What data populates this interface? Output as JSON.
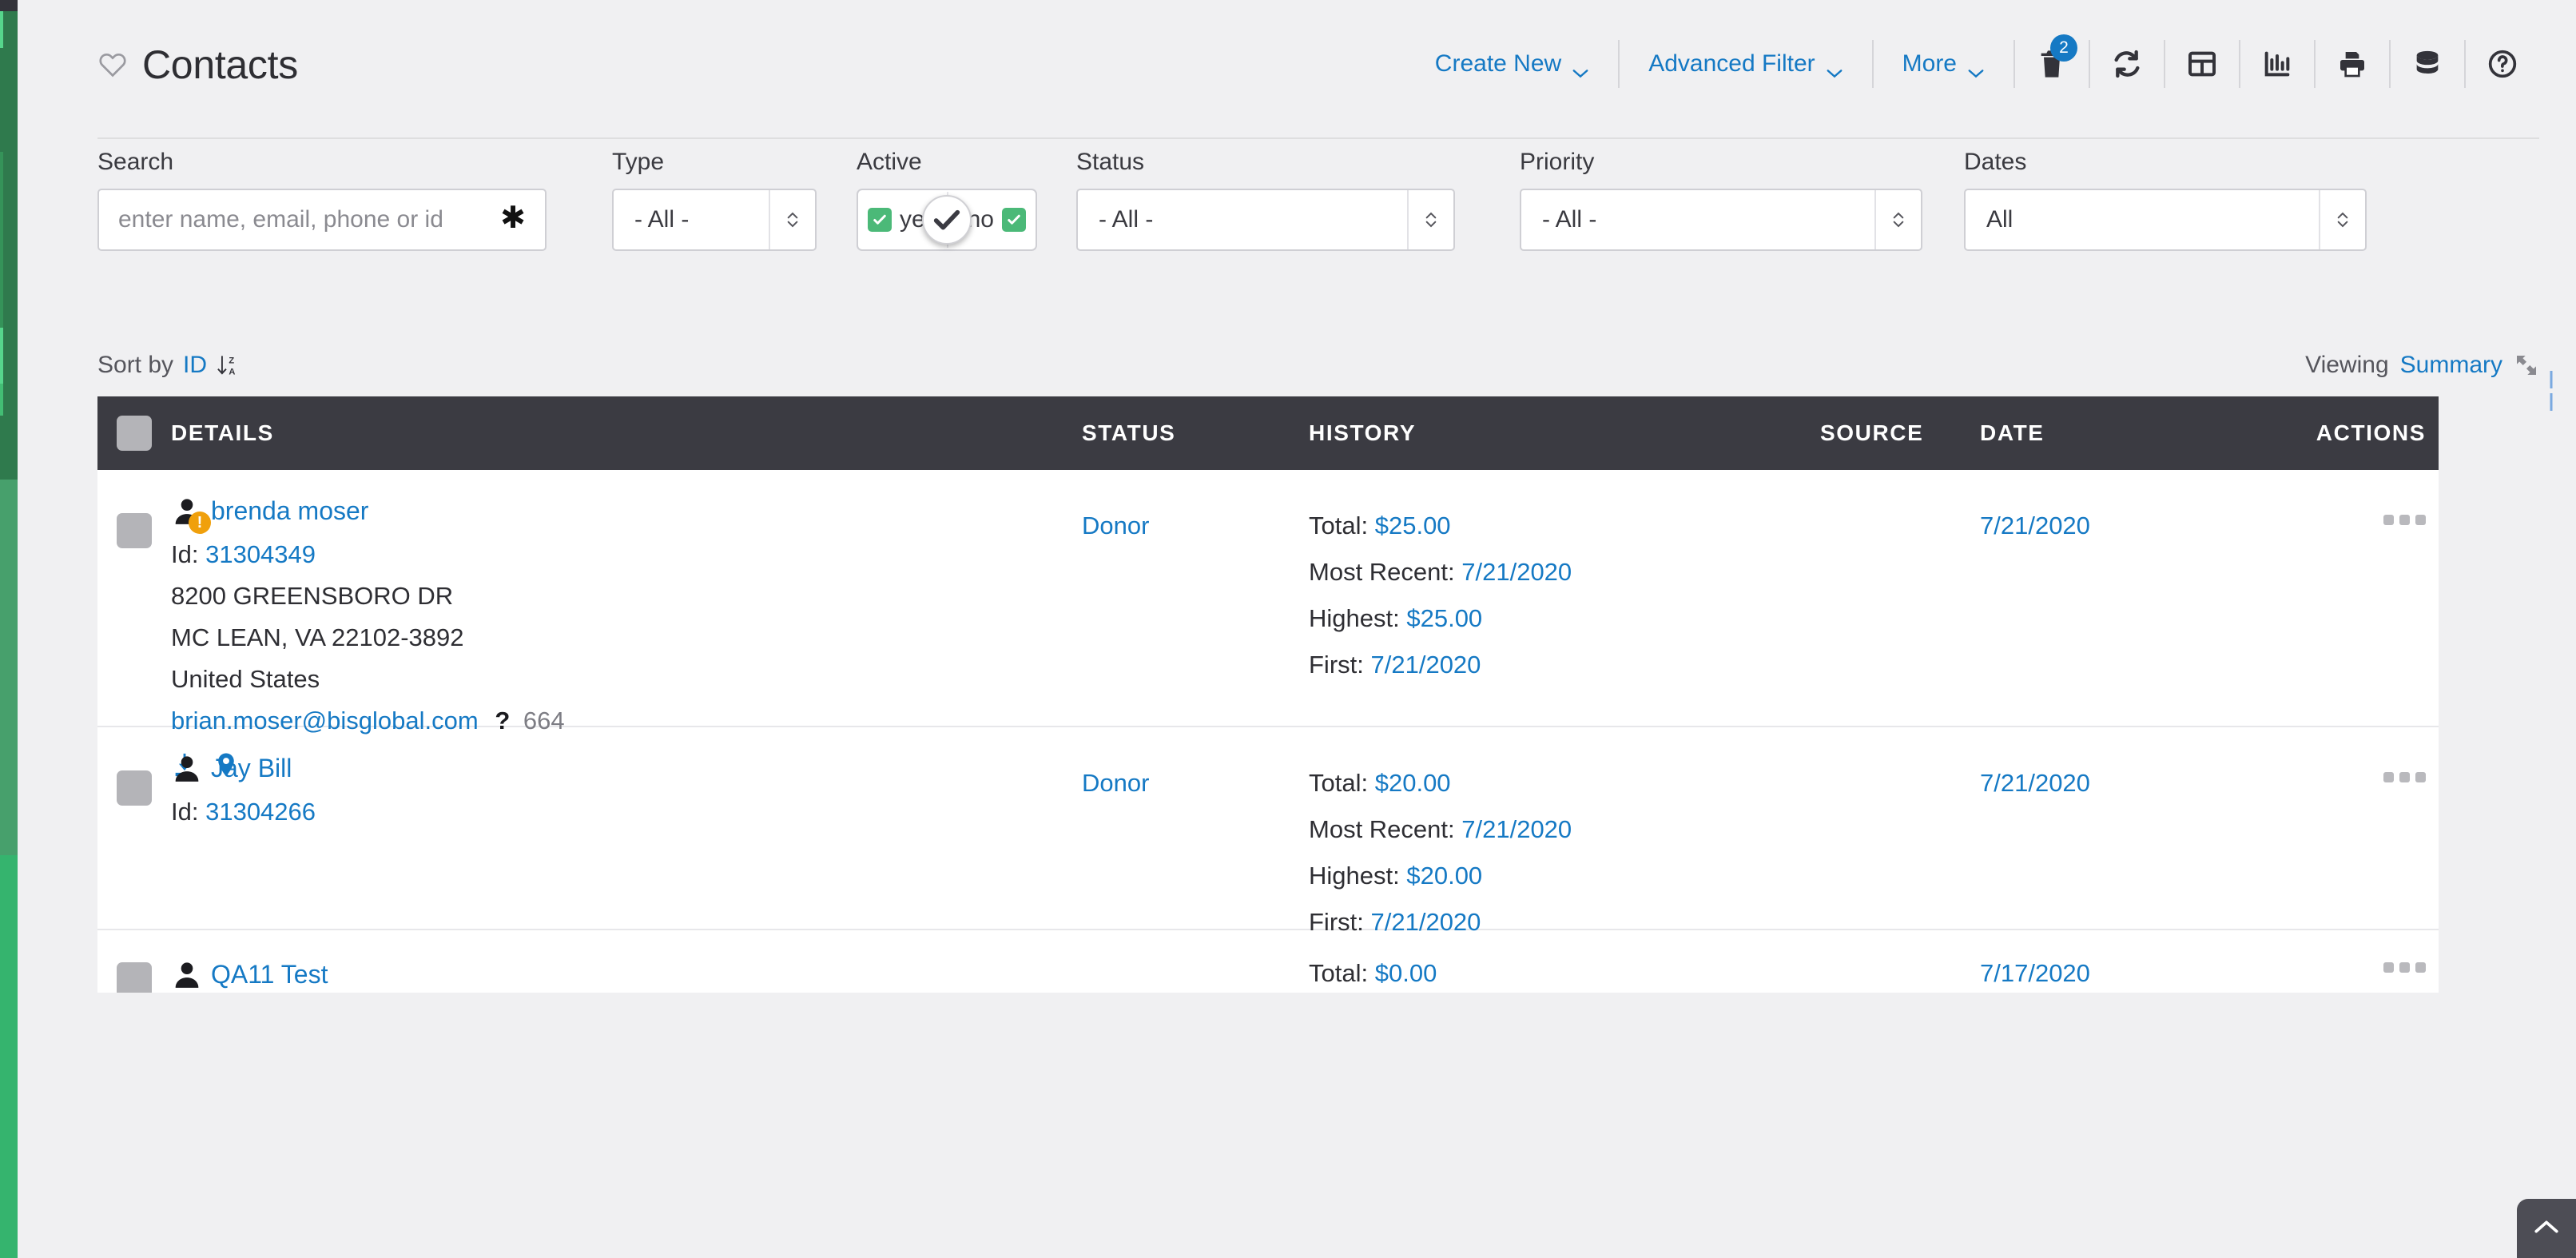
{
  "header": {
    "title": "Contacts",
    "heart_icon": "heart-outline-icon",
    "actions": [
      {
        "label": "Create New",
        "icon": "chevron-down-icon"
      },
      {
        "label": "Advanced Filter",
        "icon": "chevron-down-icon"
      },
      {
        "label": "More",
        "icon": "chevron-down-icon"
      }
    ],
    "icon_buttons": [
      {
        "name": "trash-icon",
        "badge": "2"
      },
      {
        "name": "refresh-icon",
        "badge": ""
      },
      {
        "name": "table-icon",
        "badge": ""
      },
      {
        "name": "bar-chart-icon",
        "badge": ""
      },
      {
        "name": "print-icon",
        "badge": ""
      },
      {
        "name": "database-icon",
        "badge": ""
      },
      {
        "name": "help-circle-icon",
        "badge": ""
      }
    ]
  },
  "filters": {
    "search": {
      "label": "Search",
      "placeholder": "enter name, email, phone or id",
      "value": "",
      "icon": "asterisk-icon"
    },
    "type": {
      "label": "Type",
      "value": "- All -"
    },
    "active": {
      "label": "Active",
      "yes_label": "yes",
      "no_label": "no",
      "yes_checked": true,
      "no_checked": true,
      "cursor_icon": "check-cursor-icon"
    },
    "status": {
      "label": "Status",
      "value": "- All -"
    },
    "priority": {
      "label": "Priority",
      "value": "- All -"
    },
    "dates": {
      "label": "Dates",
      "value": "All"
    }
  },
  "sortbar": {
    "sort_label": "Sort by",
    "sort_key": "ID",
    "sort_icon": "sort-descending-icon",
    "viewing_label": "Viewing",
    "viewing_value": "Summary",
    "expand_icon": "expand-arrows-icon"
  },
  "table": {
    "columns": [
      "DETAILS",
      "STATUS",
      "HISTORY",
      "SOURCE",
      "DATE",
      "ACTIONS"
    ],
    "rows": [
      {
        "name": "brenda moser",
        "has_warning": true,
        "id_label": "Id:",
        "id_value": "31304349",
        "address1": "8200 GREENSBORO DR",
        "address2": "MC LEAN, VA 22102-3892",
        "country": "United States",
        "email": "brian.moser@bisglobal.com",
        "email_suffix": "664",
        "icons": [
          "download-icon",
          "map-pin-icon"
        ],
        "status": "Donor",
        "history": [
          {
            "label": "Total:",
            "value": "$25.00"
          },
          {
            "label": "Most Recent:",
            "value": "7/21/2020"
          },
          {
            "label": "Highest:",
            "value": "$25.00"
          },
          {
            "label": "First:",
            "value": "7/21/2020"
          }
        ],
        "source": "",
        "date": "7/21/2020"
      },
      {
        "name": "Jay Bill",
        "has_warning": false,
        "id_label": "Id:",
        "id_value": "31304266",
        "address1": "",
        "address2": "",
        "country": "",
        "email": "",
        "email_suffix": "",
        "icons": [],
        "status": "Donor",
        "history": [
          {
            "label": "Total:",
            "value": "$20.00"
          },
          {
            "label": "Most Recent:",
            "value": "7/21/2020"
          },
          {
            "label": "Highest:",
            "value": "$20.00"
          },
          {
            "label": "First:",
            "value": "7/21/2020"
          }
        ],
        "source": "",
        "date": "7/21/2020"
      },
      {
        "name": "QA11 Test",
        "has_warning": false,
        "id_label": "",
        "id_value": "",
        "address1": "",
        "address2": "",
        "country": "",
        "email": "",
        "email_suffix": "",
        "icons": [],
        "status": "",
        "history": [
          {
            "label": "Total:",
            "value": "$0.00"
          }
        ],
        "source": "",
        "date": "7/17/2020"
      }
    ]
  },
  "scroll_top": {
    "icon": "chevron-up-icon"
  },
  "colors": {
    "accent_link": "#1579c4",
    "header_bar": "#3b3b42",
    "page_bg": "#f0f0f2",
    "rail_green": "#2f7a4d",
    "toggle_green": "#4bb978",
    "warning": "#f0a00c"
  }
}
